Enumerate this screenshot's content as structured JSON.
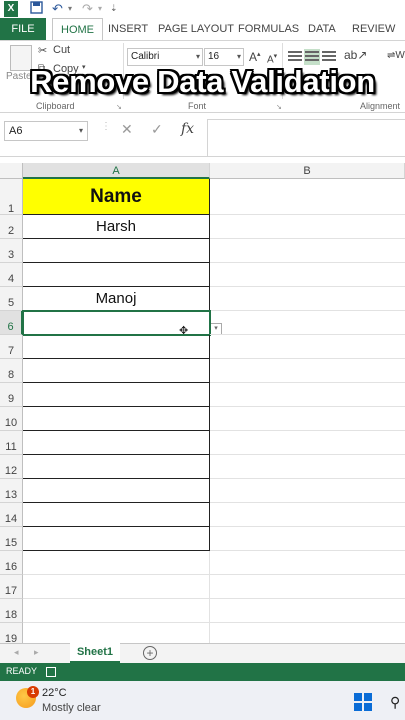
{
  "ribbon": {
    "tabs": [
      "FILE",
      "HOME",
      "INSERT",
      "PAGE LAYOUT",
      "FORMULAS",
      "DATA",
      "REVIEW"
    ],
    "cut_label": "Cut",
    "copy_label": "Copy",
    "paste_label": "Paste",
    "font_name": "Calibri",
    "font_size": "16",
    "grow_font": "A",
    "shrink_font": "A",
    "group_clipboard": "Clipboard",
    "group_font": "Font",
    "group_alignment": "Alignment"
  },
  "overlay": {
    "title": "Remove Data Validation"
  },
  "formula_bar": {
    "name_box": "A6",
    "fx_label": "fx"
  },
  "grid": {
    "columns": [
      "A",
      "B"
    ],
    "rows": [
      {
        "num": "1",
        "value": "Name"
      },
      {
        "num": "2",
        "value": "Harsh"
      },
      {
        "num": "3",
        "value": ""
      },
      {
        "num": "4",
        "value": ""
      },
      {
        "num": "5",
        "value": "Manoj"
      },
      {
        "num": "6",
        "value": ""
      },
      {
        "num": "7",
        "value": ""
      },
      {
        "num": "8",
        "value": ""
      },
      {
        "num": "9",
        "value": ""
      },
      {
        "num": "10",
        "value": ""
      },
      {
        "num": "11",
        "value": ""
      },
      {
        "num": "12",
        "value": ""
      },
      {
        "num": "13",
        "value": ""
      },
      {
        "num": "14",
        "value": ""
      },
      {
        "num": "15",
        "value": ""
      },
      {
        "num": "16",
        "value": ""
      },
      {
        "num": "17",
        "value": ""
      },
      {
        "num": "18",
        "value": ""
      },
      {
        "num": "19",
        "value": ""
      }
    ],
    "header_fill": "#ffff00",
    "accent": "#217346"
  },
  "sheets": {
    "active": "Sheet1",
    "add_symbol": "+"
  },
  "status": {
    "ready": "READY"
  },
  "taskbar": {
    "temperature": "22°C",
    "condition": "Mostly clear",
    "badge": "1"
  }
}
